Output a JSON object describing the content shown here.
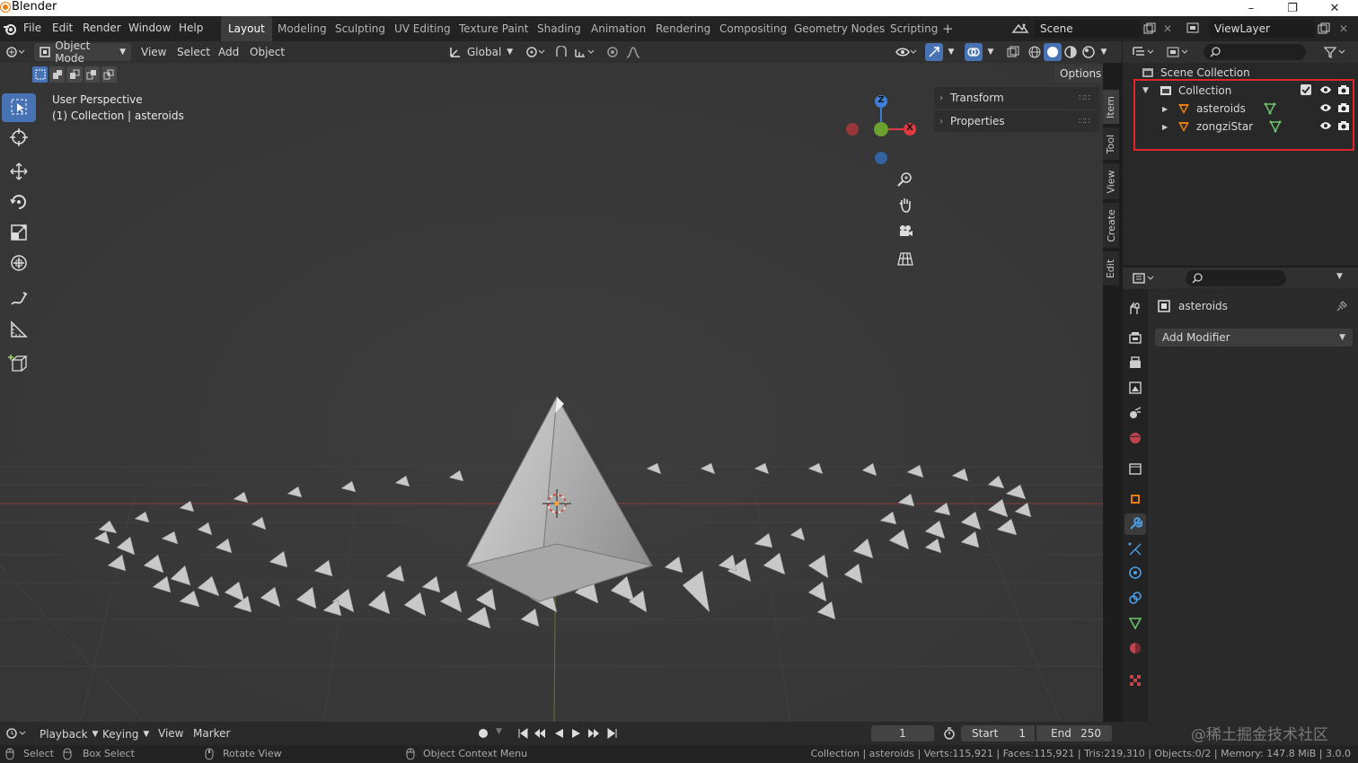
{
  "window": {
    "title": "Blender",
    "min": "–",
    "max": "❐",
    "close": "✕"
  },
  "menu": [
    "File",
    "Edit",
    "Render",
    "Window",
    "Help"
  ],
  "workspaces": [
    "Layout",
    "Modeling",
    "Sculpting",
    "UV Editing",
    "Texture Paint",
    "Shading",
    "Animation",
    "Rendering",
    "Compositing",
    "Geometry Nodes",
    "Scripting"
  ],
  "workspace_add": "+",
  "scene": {
    "name": "Scene"
  },
  "view_layer": {
    "name": "ViewLayer"
  },
  "viewport_header": {
    "mode": "Object Mode",
    "menus": [
      "View",
      "Select",
      "Add",
      "Object"
    ],
    "transform_orientation": "Global",
    "options": "Options"
  },
  "viewport": {
    "info_line1": "User Perspective",
    "info_line2": "(1) Collection | asteroids",
    "gizmo": {
      "z": "Z",
      "x": "X"
    }
  },
  "npanel": {
    "transform": "Transform",
    "properties": "Properties",
    "tabs": [
      "Item",
      "Tool",
      "View",
      "Create",
      "Edit"
    ]
  },
  "outliner": {
    "scene_collection": "Scene Collection",
    "collection": "Collection",
    "items": [
      {
        "name": "asteroids"
      },
      {
        "name": "zongziStar"
      }
    ],
    "highlight_color": "#e0242b"
  },
  "properties": {
    "object_name": "asteroids",
    "add_modifier": "Add Modifier"
  },
  "timeline": {
    "menus": [
      "Playback",
      "Keying",
      "View",
      "Marker"
    ],
    "current_frame": "1",
    "start_label": "Start",
    "start": "1",
    "end_label": "End",
    "end": "250"
  },
  "statusbar": {
    "select": "Select",
    "box_select": "Box Select",
    "rotate_view": "Rotate View",
    "context_menu": "Object Context Menu",
    "stats": "Collection | asteroids | Verts:115,921 | Faces:115,921 | Tris:219,310 | Objects:0/2 | Memory: 147.8 MiB | 3.0.0"
  },
  "watermark": "@稀土掘金技术社区",
  "colors": {
    "accent": "#4772b3",
    "active_icon": "#e87d0d",
    "axis_x": "#e0393f",
    "axis_y": "#6aa22d",
    "axis_z": "#3d7fd6"
  }
}
